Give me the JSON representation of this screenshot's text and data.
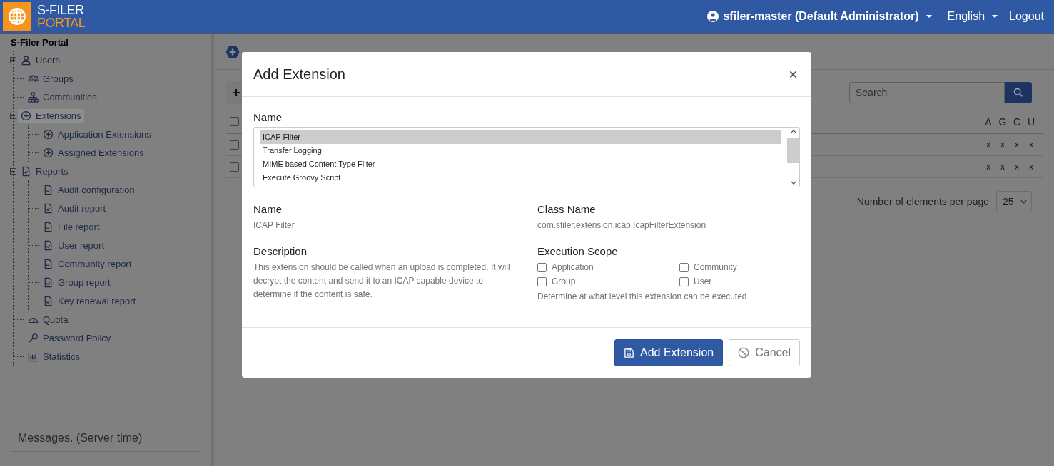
{
  "header": {
    "logo_top": "S-FILER",
    "logo_bottom": "PORTAL",
    "user": "sfiler-master (Default Administrator)",
    "language": "English",
    "logout": "Logout"
  },
  "sidebar": {
    "title": "S-Filer Portal",
    "items": [
      {
        "label": "Users",
        "kind": "user",
        "selected": false,
        "expanded": false
      },
      {
        "label": "Groups",
        "kind": "group",
        "selected": false
      },
      {
        "label": "Communities",
        "kind": "community",
        "selected": false
      },
      {
        "label": "Extensions",
        "kind": "extension",
        "selected": true,
        "expanded": true,
        "children": [
          {
            "label": "Application Extensions",
            "kind": "extension",
            "selected": false
          },
          {
            "label": "Assigned Extensions",
            "kind": "extension",
            "selected": false
          }
        ]
      },
      {
        "label": "Reports",
        "kind": "report",
        "selected": false,
        "expanded": true,
        "children": [
          {
            "label": "Audit configuration",
            "kind": "report",
            "selected": false
          },
          {
            "label": "Audit report",
            "kind": "report",
            "selected": false
          },
          {
            "label": "File report",
            "kind": "report",
            "selected": false
          },
          {
            "label": "User report",
            "kind": "report",
            "selected": false
          },
          {
            "label": "Community report",
            "kind": "report",
            "selected": false
          },
          {
            "label": "Group report",
            "kind": "report",
            "selected": false
          },
          {
            "label": "Key renewal report",
            "kind": "report",
            "selected": false
          }
        ]
      },
      {
        "label": "Quota",
        "kind": "quota",
        "selected": false
      },
      {
        "label": "Password Policy",
        "kind": "password",
        "selected": false
      },
      {
        "label": "Statistics",
        "kind": "statistics",
        "selected": false
      }
    ],
    "messages": "Messages. (Server time)"
  },
  "page": {
    "search": {
      "placeholder": "Search"
    },
    "table": {
      "all_checked": false,
      "columns": [
        "A",
        "G",
        "C",
        "U"
      ],
      "rows": [
        {
          "checked": false,
          "cells": [
            "x",
            "x",
            "x",
            "x"
          ]
        },
        {
          "checked": false,
          "cells": [
            "x",
            "x",
            "x",
            "x"
          ]
        }
      ]
    },
    "per_page": {
      "label": "Number of elements per page",
      "value": "25"
    }
  },
  "modal": {
    "title": "Add Extension",
    "list_label": "Name",
    "options": [
      {
        "label": "ICAP Filter",
        "selected": true
      },
      {
        "label": "Transfer Logging",
        "selected": false
      },
      {
        "label": "MIME based Content Type Filter",
        "selected": false
      },
      {
        "label": "Execute Groovy Script",
        "selected": false
      }
    ],
    "name_label": "Name",
    "name_value": "ICAP Filter",
    "class_label": "Class Name",
    "class_value": "com.sfiler.extension.icap.IcapFilterExtension",
    "description_label": "Description",
    "description": "This extension should be called when an upload is completed. It will decrypt the content and send it to an ICAP capable device to determine if the content is safe.",
    "scope_label": "Execution Scope",
    "scopes": [
      {
        "label": "Application",
        "checked": false
      },
      {
        "label": "Community",
        "checked": false
      },
      {
        "label": "Group",
        "checked": false
      },
      {
        "label": "User",
        "checked": false
      }
    ],
    "scope_hint": "Determine at what level this extension can be executed",
    "add_button": "Add Extension",
    "cancel_button": "Cancel"
  }
}
